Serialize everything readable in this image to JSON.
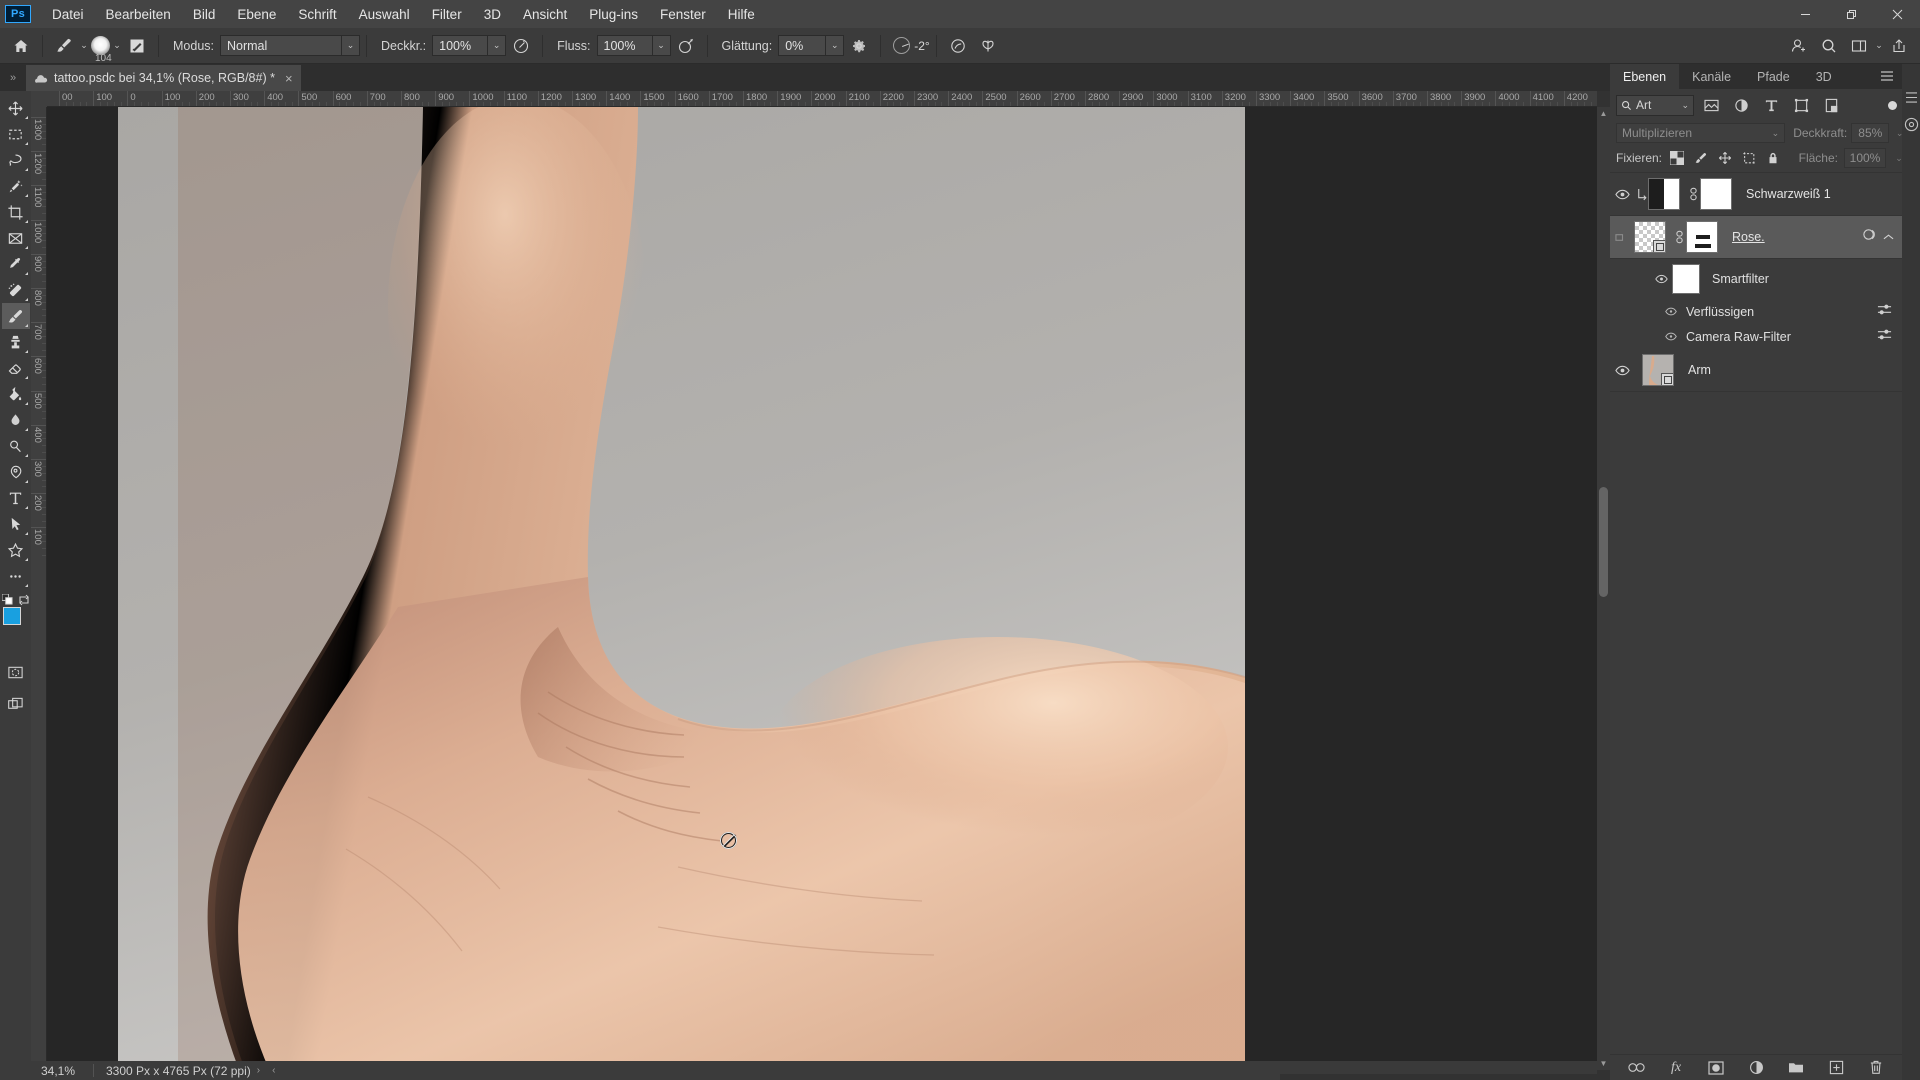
{
  "app": {
    "name": "Adobe Photoshop",
    "logo_text": "Ps"
  },
  "menubar": {
    "items": [
      {
        "label": "Datei"
      },
      {
        "label": "Bearbeiten"
      },
      {
        "label": "Bild"
      },
      {
        "label": "Ebene"
      },
      {
        "label": "Schrift"
      },
      {
        "label": "Auswahl"
      },
      {
        "label": "Filter"
      },
      {
        "label": "3D"
      },
      {
        "label": "Ansicht"
      },
      {
        "label": "Plug-ins"
      },
      {
        "label": "Fenster"
      },
      {
        "label": "Hilfe"
      }
    ],
    "window_controls": [
      "minimize",
      "restore",
      "close"
    ]
  },
  "options_bar": {
    "home_icon": "home-icon",
    "brush_tool_icon": "brush-icon",
    "brush_size": "104",
    "brush_settings_icon": "brush-settings-icon",
    "mode_label": "Modus:",
    "mode_value": "Normal",
    "opacity_label": "Deckkr.:",
    "opacity_value": "100%",
    "pressure_opacity_icon": "pressure-opacity-icon",
    "flow_label": "Fluss:",
    "flow_value": "100%",
    "airbrush_icon": "airbrush-icon",
    "smoothing_label": "Glättung:",
    "smoothing_value": "0%",
    "smoothing_options_icon": "gear-icon",
    "angle_icon": "angle-dial-icon",
    "angle_value": "-2°",
    "pressure_size_icon": "pressure-size-icon",
    "symmetry_icon": "symmetry-butterfly-icon",
    "right_icons": [
      "share-workspace-icon",
      "search-icon",
      "workspace-icon"
    ]
  },
  "document_tab": {
    "title": "tattoo.psdc bei 34,1% (Rose, RGB/8#) *",
    "close_label": "×",
    "cloud_icon": "cloud-document-icon"
  },
  "rulers": {
    "unit": "px",
    "h_labels": [
      "00",
      "100",
      "0",
      "100",
      "200",
      "300",
      "400",
      "500",
      "600",
      "700",
      "800",
      "900",
      "1000",
      "1100",
      "1200",
      "1300",
      "1400",
      "1500",
      "1600",
      "1700",
      "1800",
      "1900",
      "2000",
      "2100",
      "2200",
      "2300",
      "2400",
      "2500",
      "2600",
      "2700",
      "2800",
      "2900",
      "3000",
      "3100",
      "3200",
      "3300",
      "3400",
      "3500",
      "3600",
      "3700",
      "3800",
      "3900",
      "4000",
      "4100",
      "4200",
      "4"
    ],
    "v_labels": [
      "1300",
      "1200",
      "1100",
      "1000",
      "900",
      "800",
      "700",
      "600",
      "500",
      "400",
      "300",
      "200",
      "100"
    ]
  },
  "canvas": {
    "cursor": "not-allowed-cursor",
    "image_description": "arm-photo"
  },
  "toolbar": {
    "tools": [
      {
        "name": "move-tool",
        "icon": "move-icon",
        "active": false
      },
      {
        "name": "rectangular-marquee-tool",
        "icon": "marquee-icon",
        "active": false
      },
      {
        "name": "lasso-tool",
        "icon": "lasso-icon",
        "active": false
      },
      {
        "name": "quick-selection-tool",
        "icon": "magic-wand-icon",
        "active": false
      },
      {
        "name": "crop-tool",
        "icon": "crop-icon",
        "active": false
      },
      {
        "name": "frame-tool",
        "icon": "frame-icon",
        "active": false
      },
      {
        "name": "eyedropper-tool",
        "icon": "eyedropper-icon",
        "active": false
      },
      {
        "name": "spot-healing-brush-tool",
        "icon": "healing-brush-icon",
        "active": false
      },
      {
        "name": "brush-tool",
        "icon": "brush-icon",
        "active": true
      },
      {
        "name": "clone-stamp-tool",
        "icon": "stamp-icon",
        "active": false
      },
      {
        "name": "eraser-tool",
        "icon": "eraser-icon",
        "active": false
      },
      {
        "name": "gradient-tool",
        "icon": "paint-bucket-icon",
        "active": false
      },
      {
        "name": "blur-tool",
        "icon": "blur-drop-icon",
        "active": false
      },
      {
        "name": "dodge-tool",
        "icon": "dodge-icon",
        "active": false
      },
      {
        "name": "pen-tool",
        "icon": "pen-icon",
        "active": false
      },
      {
        "name": "type-tool",
        "icon": "type-t-icon",
        "active": false
      },
      {
        "name": "path-selection-tool",
        "icon": "path-arrow-icon",
        "active": false
      },
      {
        "name": "custom-shape-tool",
        "icon": "star-shape-icon",
        "active": false
      },
      {
        "name": "edit-toolbar",
        "icon": "ellipsis-icon",
        "active": false
      }
    ],
    "default_colors_icon": "default-colors-icon",
    "swap_colors_icon": "swap-colors-icon",
    "foreground_color": "#19a0e0",
    "background_color": "#ffffff",
    "quick_mask_icon": "quick-mask-icon",
    "screen_mode_icon": "screen-mode-icon"
  },
  "panels": {
    "tabs": [
      {
        "label": "Ebenen",
        "active": true
      },
      {
        "label": "Kanäle",
        "active": false
      },
      {
        "label": "Pfade",
        "active": false
      },
      {
        "label": "3D",
        "active": false
      }
    ],
    "panel_menu_icon": "hamburger-icon",
    "filter": {
      "kind_label": "Art",
      "search_icon": "search-icon",
      "filter_icons": [
        "pixel-layer-filter-icon",
        "adjustment-layer-filter-icon",
        "type-layer-filter-icon",
        "shape-layer-filter-icon",
        "smart-object-filter-icon"
      ],
      "toggle_icon": "filter-toggle-icon"
    },
    "blend": {
      "mode_value": "Multiplizieren",
      "opacity_label": "Deckkraft:",
      "opacity_value": "85%"
    },
    "lock": {
      "label": "Fixieren:",
      "icons": [
        "lock-transparency-icon",
        "lock-image-icon",
        "lock-position-icon",
        "lock-artboard-icon",
        "lock-all-icon"
      ],
      "fill_label": "Fläche:",
      "fill_value": "100%"
    },
    "layers": [
      {
        "name": "Schwarzweiß 1",
        "visible": true,
        "selected": false,
        "clipped": true,
        "thumb_type": "half",
        "mask": true,
        "link_icon": "link-icon"
      },
      {
        "name": "Rose.",
        "visible": false,
        "selected": true,
        "clipped": false,
        "thumb_type": "checker",
        "smart_object": true,
        "mask": true,
        "link_icon": "link-icon",
        "fx_badge": "smart-filter-badge-icon",
        "expand_icon": "chevron-up-icon"
      }
    ],
    "smart_filters": {
      "group_label": "Smartfilter",
      "group_visible": true,
      "items": [
        {
          "label": "Verflüssigen",
          "visible": true,
          "settings_icon": "filter-settings-icon"
        },
        {
          "label": "Camera Raw-Filter",
          "visible": true,
          "settings_icon": "filter-settings-icon"
        }
      ]
    },
    "bottom_layer": {
      "name": "Arm",
      "visible": true,
      "thumb_type": "photo",
      "smart_object": true
    },
    "footer_icons": [
      {
        "name": "link-layers-icon",
        "label": "∞"
      },
      {
        "name": "layer-style-fx-icon",
        "label": "fx"
      },
      {
        "name": "add-layer-mask-icon",
        "label": ""
      },
      {
        "name": "new-adjustment-layer-icon",
        "label": ""
      },
      {
        "name": "new-group-icon",
        "label": ""
      },
      {
        "name": "new-layer-icon",
        "label": "+"
      },
      {
        "name": "delete-layer-icon",
        "label": ""
      }
    ]
  },
  "status_bar": {
    "zoom": "34,1%",
    "dimensions": "3300 Px x 4765 Px (72 ppi)",
    "next_arrow": "›",
    "prev_arrow": "‹"
  }
}
